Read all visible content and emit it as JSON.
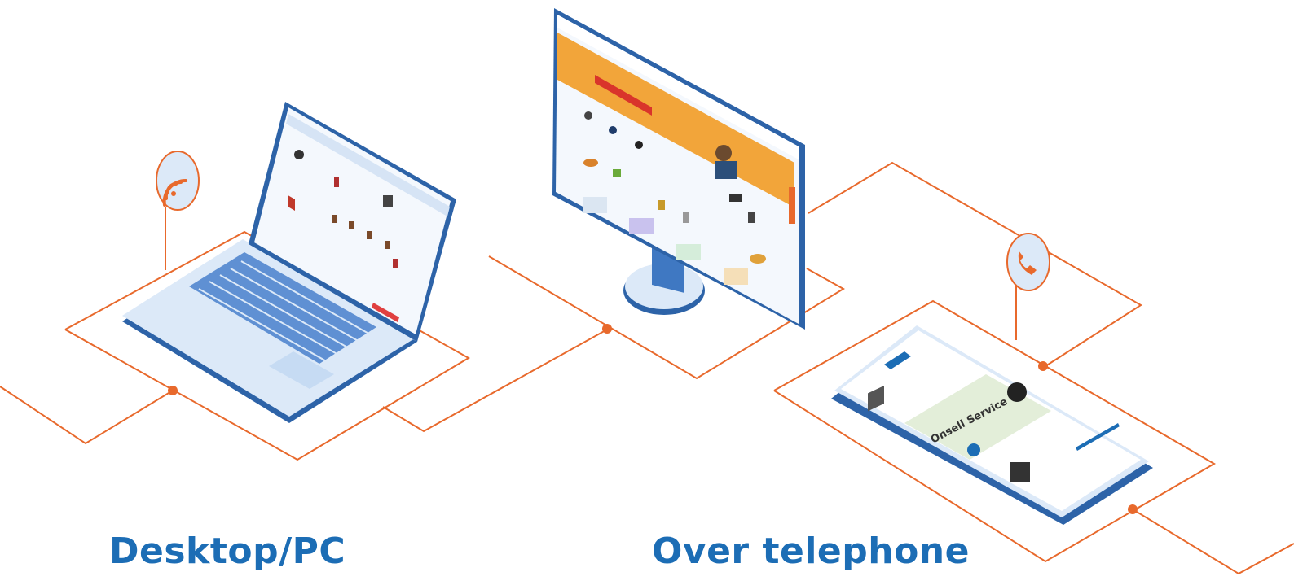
{
  "captions": {
    "desktop": "Desktop/PC",
    "telephone": "Over telephone"
  },
  "phone_screen": {
    "service_heading": "Onsell Service"
  },
  "icons": {
    "wifi": "wifi-icon",
    "phone": "phone-icon"
  },
  "colors": {
    "caption": "#1c6db5",
    "network_line": "#e8692c",
    "device_frame": "#2d63a8",
    "device_light": "#dce9f8",
    "banner": "#f2a53a"
  }
}
